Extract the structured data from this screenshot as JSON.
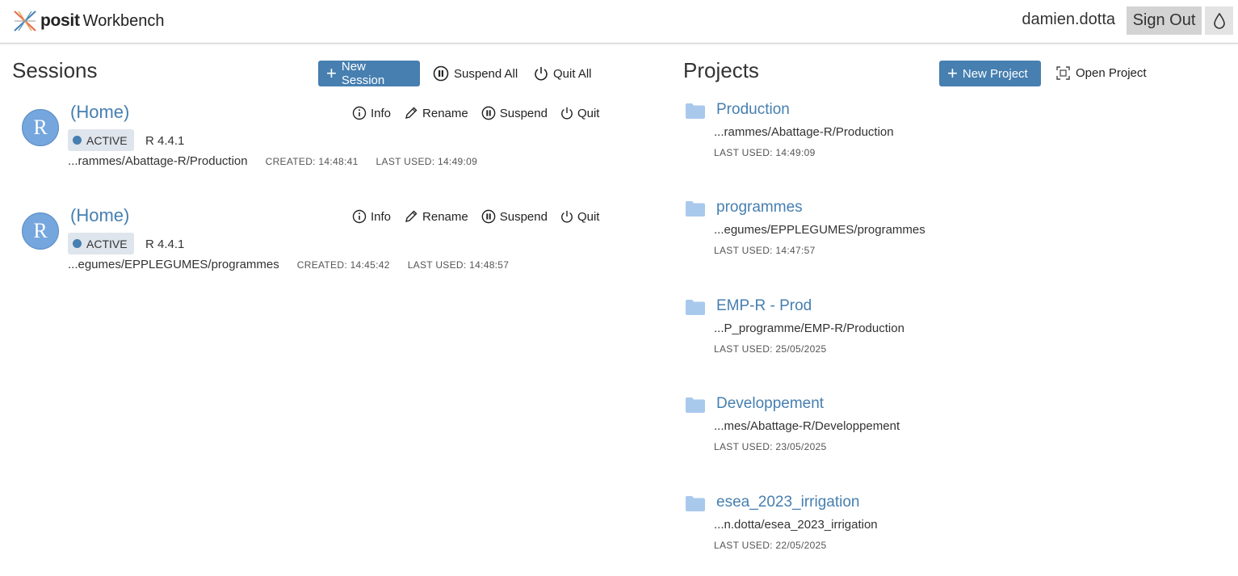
{
  "header": {
    "brand": "posit",
    "product": "Workbench",
    "username": "damien.dotta",
    "sign_out_label": "Sign Out"
  },
  "sessions_panel": {
    "title": "Sessions",
    "new_session_label": "New Session",
    "suspend_all_label": "Suspend All",
    "quit_all_label": "Quit All",
    "action_labels": {
      "info": "Info",
      "rename": "Rename",
      "suspend": "Suspend",
      "quit": "Quit"
    },
    "sessions": [
      {
        "avatar_letter": "R",
        "name": "(Home)",
        "status": "ACTIVE",
        "r_version": "R 4.4.1",
        "path": "...rammes/Abattage-R/Production",
        "created": "CREATED: 14:48:41",
        "last_used": "LAST USED: 14:49:09"
      },
      {
        "avatar_letter": "R",
        "name": "(Home)",
        "status": "ACTIVE",
        "r_version": "R 4.4.1",
        "path": "...egumes/EPPLEGUMES/programmes",
        "created": "CREATED: 14:45:42",
        "last_used": "LAST USED: 14:48:57"
      }
    ]
  },
  "projects_panel": {
    "title": "Projects",
    "new_project_label": "New Project",
    "open_project_label": "Open Project",
    "projects": [
      {
        "name": "Production",
        "path": "...rammes/Abattage-R/Production",
        "last_used": "LAST USED: 14:49:09"
      },
      {
        "name": "programmes",
        "path": "...egumes/EPPLEGUMES/programmes",
        "last_used": "LAST USED: 14:47:57"
      },
      {
        "name": "EMP-R - Prod",
        "path": "...P_programme/EMP-R/Production",
        "last_used": "LAST USED: 25/05/2025"
      },
      {
        "name": "Developpement",
        "path": "...mes/Abattage-R/Developpement",
        "last_used": "LAST USED: 23/05/2025"
      },
      {
        "name": "esea_2023_irrigation",
        "path": "...n.dotta/esea_2023_irrigation",
        "last_used": "LAST USED: 22/05/2025"
      }
    ]
  },
  "colors": {
    "accent": "#467fb0",
    "avatar": "#75a6de",
    "folder": "#a9c9ec",
    "badge_bg": "#dfe5ec"
  },
  "icons": [
    "posit-logo-icon",
    "droplet-icon",
    "plus-icon",
    "pause-circle-icon",
    "power-icon",
    "info-icon",
    "pencil-icon",
    "folder-icon",
    "open-project-icon"
  ]
}
